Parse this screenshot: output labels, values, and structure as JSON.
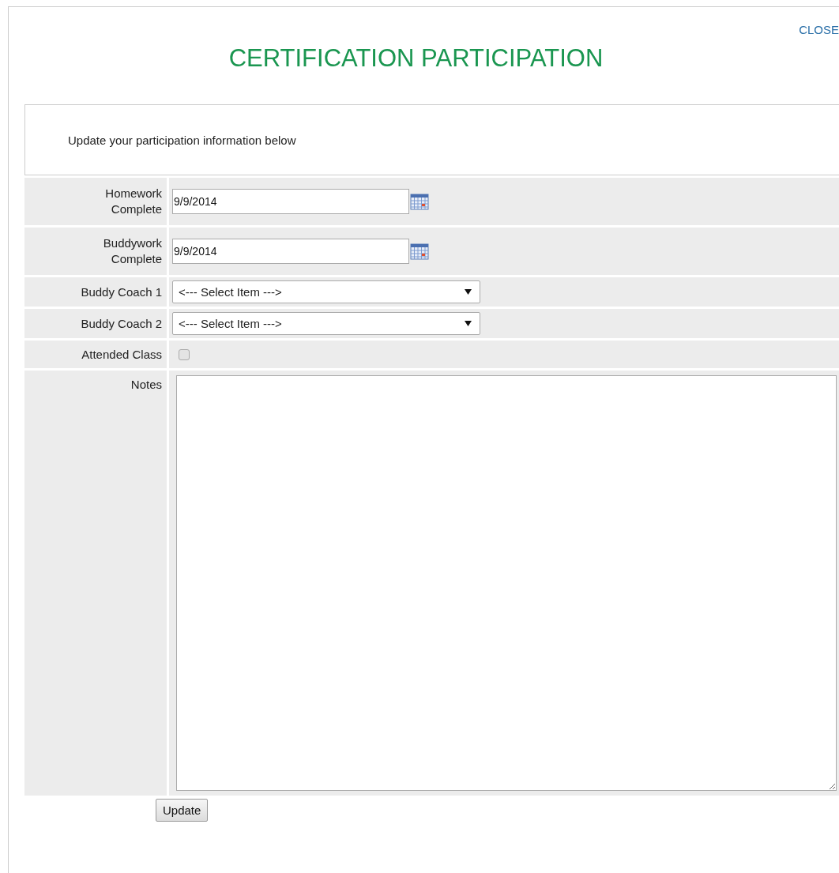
{
  "close_link": "CLOSE",
  "title": "CERTIFICATION PARTICIPATION",
  "intro": "Update your participation information below",
  "rows": [
    {
      "kind": "date",
      "label": "Homework Complete",
      "value": "9/9/2014"
    },
    {
      "kind": "date",
      "label": "Buddywork Complete",
      "value": "9/9/2014"
    },
    {
      "kind": "select",
      "label": "Buddy Coach 1",
      "value": "<--- Select Item --->"
    },
    {
      "kind": "select",
      "label": "Buddy Coach 2",
      "value": "<--- Select Item --->"
    },
    {
      "kind": "checkbox",
      "label": "Attended Class",
      "checked": false
    },
    {
      "kind": "textarea",
      "label": "Notes"
    }
  ],
  "submit_button": "Update"
}
